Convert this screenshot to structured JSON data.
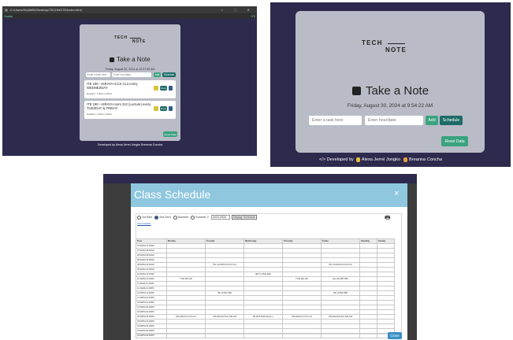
{
  "panel1": {
    "address": "C:/Users/HUAWEI/Desktop/TECHNOTE/index.html",
    "tab_label": "Ccaids",
    "right_label": "ITS",
    "logo_top": "TECH",
    "logo_bottom": "NOTE",
    "heading": "Take a Note",
    "date": "Friday, August 30, 2024 at 10:07:55 AM",
    "task_placeholder": "Enter a task here",
    "date_placeholder": "Enter hour/date",
    "add_label": "Add",
    "schedule_label": "Schedule",
    "notes": [
      {
        "title": "ITE 190 - HIRAYA ICCS CL3 every WEDNESDAY",
        "deadline": "Deadline: 1:30pm-4:30pm",
        "done_label": "Done"
      },
      {
        "title": "ITE 190 - HIRAYA room 312 (Lecture) every TUESDAY & FRIDAY",
        "deadline": "Deadline: 1:30pm-3:30pm",
        "done_label": "Done"
      }
    ],
    "reset_label": "Reset Data",
    "footer": "Developed by  Alexa Jerrel Jongko   Breanna Concha"
  },
  "panel2": {
    "logo_top": "TECH",
    "logo_bottom": "NOTE",
    "heading": "Take a Note",
    "date": "Friday, August 30, 2024 at 9:54:22 AM",
    "task_placeholder": "Enter a task here",
    "date_placeholder": "Enter hour/date",
    "add_label": "Add",
    "schedule_label": "Schedule",
    "reset_label": "Reset Data",
    "footer_prefix": "</> Developed by",
    "dev1": "Alexa Jerrel Jongko",
    "dev2": "Breanna Concha"
  },
  "panel3": {
    "title": "Class Schedule",
    "close_x": "×",
    "radio_labels": [
      "1st Sem",
      "2nd Sem",
      "Summer",
      "Summer 2"
    ],
    "year": "2023-2024",
    "display_label": "Display Schedule",
    "show_details": "Show Details",
    "headers": [
      "Time",
      "Monday",
      "Tuesday",
      "Wednesday",
      "Thursday",
      "Friday",
      "Saturday",
      "Sunday"
    ],
    "times": [
      "07:00AM-07:30AM",
      "07:30AM-08:00AM",
      "08:00AM-08:30AM",
      "08:30AM-09:00AM",
      "09:00AM-09:30AM",
      "09:30AM-10:00AM",
      "10:00AM-10:30AM",
      "10:30AM-11:00AM",
      "11:00AM-11:30AM",
      "11:30AM-12:00PM",
      "12:00PM-12:30PM",
      "12:30PM-01:00PM",
      "01:00PM-01:30PM",
      "01:30PM-02:00PM",
      "02:00PM-02:30PM",
      "02:30PM-03:00PM",
      "03:00PM-03:30PM",
      "03:30PM-04:00PM",
      "04:00PM-04:30PM",
      "04:30PM-05:00PM"
    ],
    "entries": [
      {
        "row": 4,
        "col": 2,
        "text": "ITE 14 HIRAYA ICCS CL3"
      },
      {
        "row": 4,
        "col": 5,
        "text": "ITE 14 HIRAYA ICCS CL3"
      },
      {
        "row": 6,
        "col": 3,
        "text": "IENT 3 PHE DEF"
      },
      {
        "row": 7,
        "col": 1,
        "text": "TCW RM 102"
      },
      {
        "row": 7,
        "col": 4,
        "text": "TCW RM 102"
      },
      {
        "row": 7,
        "col": 5,
        "text": "GE 100 RM TBD"
      },
      {
        "row": 10,
        "col": 2,
        "text": "ITE 15 RM TBD"
      },
      {
        "row": 10,
        "col": 5,
        "text": "ITE 15 RM TBD"
      },
      {
        "row": 15,
        "col": 1,
        "text": "LIB HIRAYA ICCS CL3"
      },
      {
        "row": 15,
        "col": 2,
        "text": "LIB MAGSAYSAY RM 106"
      },
      {
        "row": 15,
        "col": 3,
        "text": "PE MASTERS Room 1"
      },
      {
        "row": 15,
        "col": 4,
        "text": "LIB HIRAYA ICCS CL3"
      },
      {
        "row": 15,
        "col": 5,
        "text": "LIB MAGSAYSAY RM 106"
      }
    ],
    "close_label": "Close"
  },
  "colors": {
    "page_bg": "#2d2a4e",
    "card": "#b9bcc6",
    "teal": "#1e6b68",
    "green_button": "#3aa37f",
    "modal_header": "#8fc7df"
  }
}
